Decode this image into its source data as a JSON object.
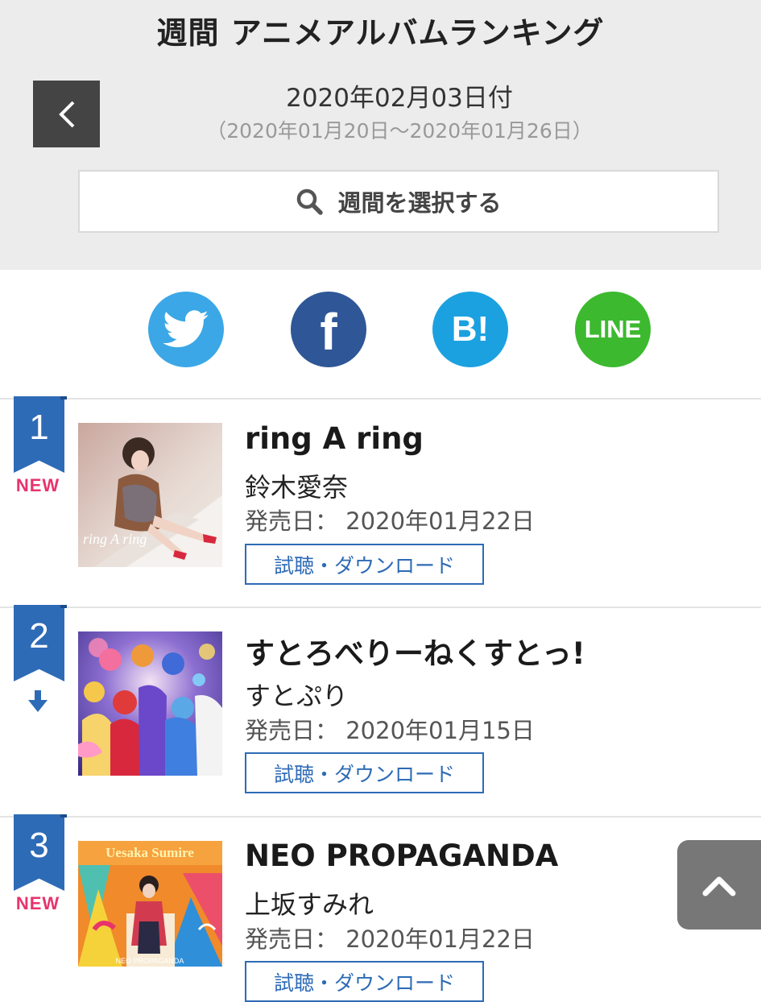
{
  "page": {
    "title": "週間 アニメアルバムランキング",
    "date_main": "2020年02月03日付",
    "date_range": "（2020年01月20日～2020年01月26日）",
    "week_select_label": "週間を選択する"
  },
  "share": {
    "twitter": "Twitter",
    "facebook": "f",
    "hatena": "B!",
    "line": "LINE"
  },
  "release_label": "発売日：",
  "download_label": "試聴・ダウンロード",
  "rankings": [
    {
      "rank": "1",
      "status": "NEW",
      "title": "ring A ring",
      "artist": "鈴木愛奈",
      "release_date": "2020年01月22日",
      "cover_text": "ring A ring"
    },
    {
      "rank": "2",
      "status": "down",
      "title": "すとろべりーねくすとっ!",
      "artist": "すとぷり",
      "release_date": "2020年01月15日",
      "cover_text": ""
    },
    {
      "rank": "3",
      "status": "NEW",
      "title": "NEO PROPAGANDA",
      "artist": "上坂すみれ",
      "release_date": "2020年01月22日",
      "cover_text": "Uesaka Sumire",
      "cover_subtext": "NEO PROPAGANDA"
    }
  ],
  "colors": {
    "accent": "#2e6bb6",
    "new": "#e8336c",
    "twitter": "#3ba7e6",
    "facebook": "#2f5797",
    "hatena": "#1ba1e0",
    "line": "#3cb92f"
  }
}
